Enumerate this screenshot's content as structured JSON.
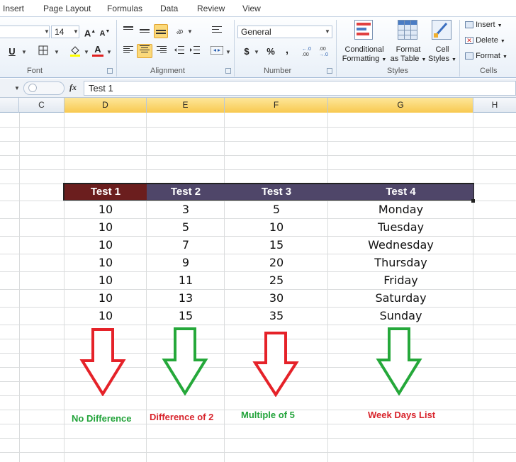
{
  "menu": {
    "tabs": [
      "Insert",
      "Page Layout",
      "Formulas",
      "Data",
      "Review",
      "View"
    ]
  },
  "ribbon": {
    "font": {
      "size": "14",
      "label": "Font"
    },
    "alignment": {
      "label": "Alignment"
    },
    "number": {
      "format": "General",
      "currency": "$",
      "percent": "%",
      "comma": ",",
      "label": "Number"
    },
    "styles": {
      "conditional_line1": "Conditional",
      "conditional_line2": "Formatting",
      "table_line1": "Format",
      "table_line2": "as Table",
      "cell_line1": "Cell",
      "cell_line2": "Styles",
      "label": "Styles"
    },
    "cells": {
      "insert": "Insert",
      "delete": "Delete",
      "format": "Format",
      "label": "Cells"
    }
  },
  "formula_bar": {
    "fx": "fx",
    "value": "Test 1"
  },
  "columns": [
    "C",
    "D",
    "E",
    "F",
    "G",
    "H"
  ],
  "table": {
    "headers": [
      "Test 1",
      "Test 2",
      "Test 3",
      "Test 4"
    ],
    "rows": [
      [
        "10",
        "3",
        "5",
        "Monday"
      ],
      [
        "10",
        "5",
        "10",
        "Tuesday"
      ],
      [
        "10",
        "7",
        "15",
        "Wednesday"
      ],
      [
        "10",
        "9",
        "20",
        "Thursday"
      ],
      [
        "10",
        "11",
        "25",
        "Friday"
      ],
      [
        "10",
        "13",
        "30",
        "Saturday"
      ],
      [
        "10",
        "15",
        "35",
        "Sunday"
      ]
    ]
  },
  "annotations": [
    {
      "text": "No Difference",
      "color": "#22a33a",
      "arrow": "green"
    },
    {
      "text": "Difference of 2",
      "color": "#d8242c",
      "arrow": "green"
    },
    {
      "text": "Multiple of 5",
      "color": "#22a33a",
      "arrow": "red"
    },
    {
      "text": "Week Days List",
      "color": "#d8242c",
      "arrow": "green"
    }
  ],
  "arrows": [
    "red-down-arrow",
    "green-down-arrow",
    "red-down-arrow",
    "green-down-arrow"
  ],
  "colors": {
    "header_first": "#6b1e1e",
    "header_rest": "#4f4669",
    "arrow_red": "#e52229",
    "arrow_green": "#25a83a"
  }
}
